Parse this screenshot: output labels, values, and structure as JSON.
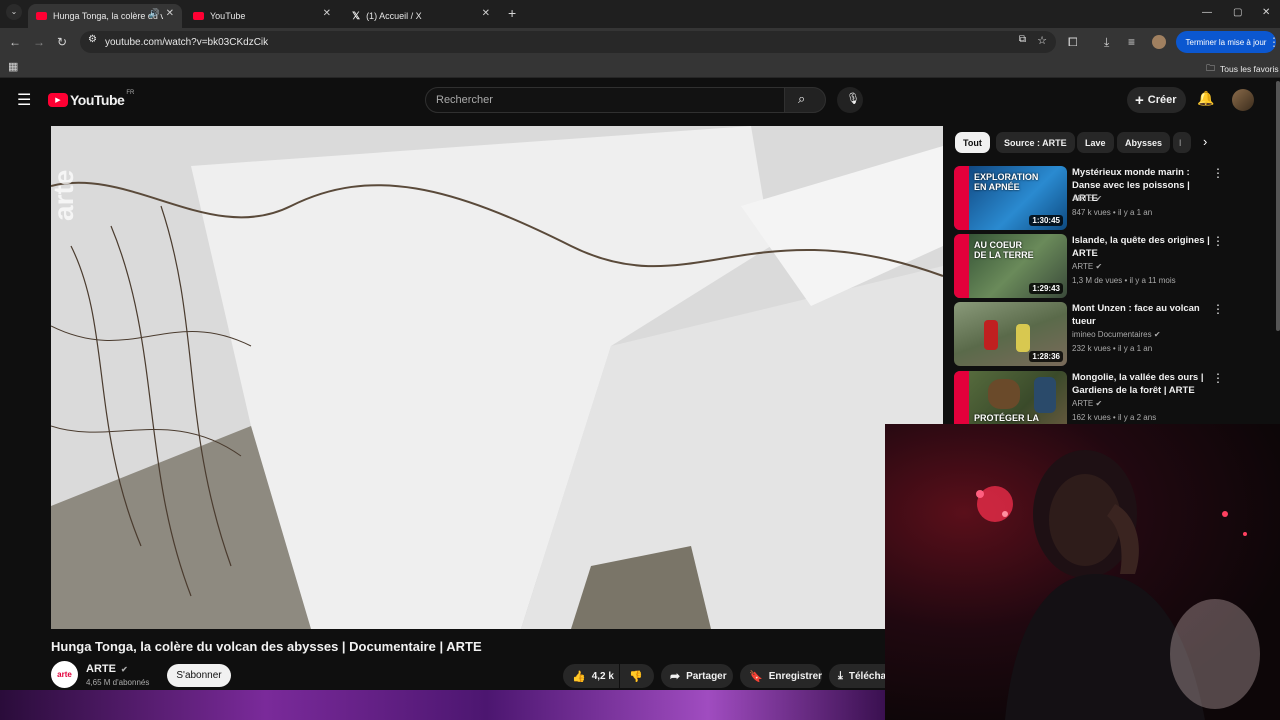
{
  "browser": {
    "tabs": [
      {
        "title": "Hunga Tonga, la colère du v",
        "active": true
      },
      {
        "title": "YouTube",
        "active": false
      },
      {
        "title": "(1) Accueil / X",
        "active": false
      }
    ],
    "url": "youtube.com/watch?v=bk03CKdzCik",
    "update_button": "Terminer la mise à jour",
    "bookmarks_label": "Tous les favoris"
  },
  "youtube": {
    "logo_text": "YouTube",
    "logo_region": "FR",
    "search_placeholder": "Rechercher",
    "create_label": "Créer",
    "video": {
      "title": "Hunga Tonga, la colère du volcan des abysses | Documentaire | ARTE",
      "channel_logo": "arte",
      "channel": "ARTE",
      "subscribers": "4,65 M d'abonnés",
      "subscribe_label": "S'abonner",
      "likes": "4,2 k",
      "share_label": "Partager",
      "save_label": "Enregistrer",
      "download_label": "Téléchar",
      "watermark": "arte"
    },
    "chips": [
      "Tout",
      "Source : ARTE",
      "Lave",
      "Abysses",
      "I"
    ],
    "recommendations": [
      {
        "title": "Mystérieux monde marin : Danse avec les poissons | ARTE",
        "channel": "ARTE",
        "views": "847 k vues",
        "age": "il y a 1 an",
        "duration": "1:30:45",
        "overlay": "EXPLORATION\nEN APNÉE",
        "thumb_color": "#1b6fb0"
      },
      {
        "title": "Islande, la quête des origines | ARTE",
        "channel": "ARTE",
        "views": "1,3 M de vues",
        "age": "il y a 11 mois",
        "duration": "1:29:43",
        "overlay": "AU COEUR\nDE LA TERRE",
        "thumb_color": "#3d5a3a"
      },
      {
        "title": "Mont Unzen : face au volcan tueur",
        "channel": "imineo Documentaires",
        "views": "232 k vues",
        "age": "il y a 1 an",
        "duration": "1:28:36",
        "overlay": "",
        "thumb_color": "#6a7a5a"
      },
      {
        "title": "Mongolie, la vallée des ours | Gardiens de la forêt | ARTE",
        "channel": "ARTE",
        "views": "162 k vues",
        "age": "il y a 2 ans",
        "duration": "",
        "overlay": "PROTÉGER LA",
        "thumb_color": "#4a5a3a"
      }
    ]
  }
}
